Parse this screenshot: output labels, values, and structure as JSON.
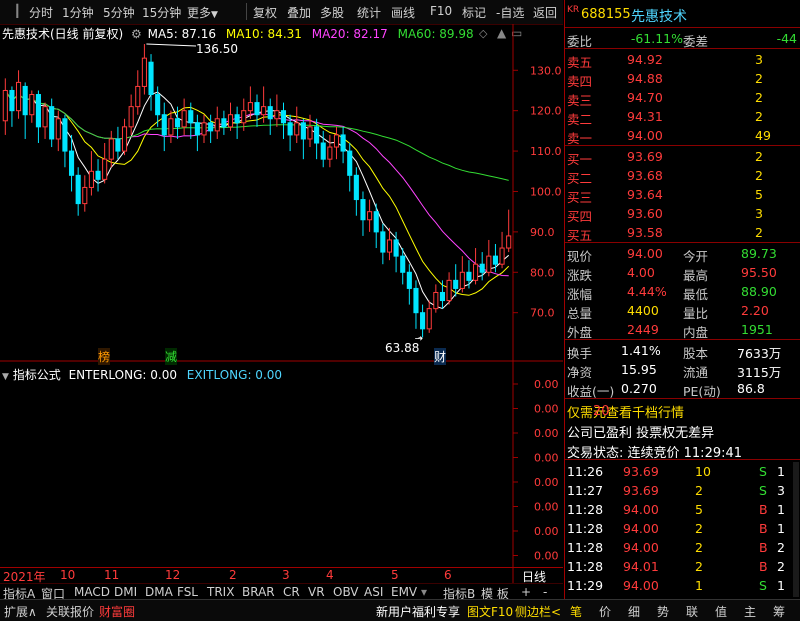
{
  "toolbar": {
    "left": [
      "分时",
      "1分钟",
      "5分钟",
      "15分钟",
      "更多"
    ],
    "right": [
      "复权",
      "叠加",
      "多股",
      "统计",
      "画线",
      "F10",
      "标记",
      "-自选",
      "返回"
    ]
  },
  "chart": {
    "title": "先惠技术(日线 前复权)",
    "ma": [
      {
        "label": "MA5: 87.16",
        "color": "#ffffff"
      },
      {
        "label": "MA10: 84.31",
        "color": "#ffff00"
      },
      {
        "label": "MA20: 82.17",
        "color": "#ff44ff"
      },
      {
        "label": "MA60: 89.98",
        "color": "#33dd33"
      }
    ],
    "y_ticks": [
      "130.0",
      "120.0",
      "110.0",
      "100.0",
      "90.0",
      "80.0",
      "70.0"
    ],
    "y_values": [
      130,
      120,
      110,
      100,
      90,
      80,
      70
    ],
    "high_label": "136.50",
    "low_label": "63.88",
    "markers": [
      {
        "text": "榜",
        "color": "#ff9900"
      },
      {
        "text": "减",
        "color": "#33dd33"
      },
      {
        "text": "财",
        "color": "#ffffff"
      }
    ],
    "x_labels": [
      "2021年",
      "10",
      "11",
      "12",
      "2",
      "3",
      "4",
      "5",
      "6"
    ],
    "period": "日线",
    "candles": [
      [
        117.5,
        125,
        128,
        114
      ],
      [
        125,
        120,
        126,
        116
      ],
      [
        120,
        127,
        130,
        118
      ],
      [
        126,
        119,
        127,
        113
      ],
      [
        119,
        124,
        125,
        117
      ],
      [
        124,
        116,
        125,
        112
      ],
      [
        116,
        121,
        122,
        113
      ],
      [
        121,
        113,
        123,
        111
      ],
      [
        113,
        118,
        120,
        110
      ],
      [
        118,
        110,
        119,
        106
      ],
      [
        110,
        104,
        114,
        100
      ],
      [
        104,
        97,
        106,
        94
      ],
      [
        97,
        101,
        104,
        95
      ],
      [
        101,
        105,
        110,
        99
      ],
      [
        105,
        103,
        108,
        100
      ],
      [
        103,
        108,
        112,
        102
      ],
      [
        108,
        113,
        115,
        106
      ],
      [
        113,
        110,
        116,
        108
      ],
      [
        110,
        116,
        118,
        109
      ],
      [
        116,
        121,
        124,
        114
      ],
      [
        121,
        126,
        130,
        119
      ],
      [
        126,
        133,
        136.5,
        124
      ],
      [
        132,
        124,
        134,
        120
      ],
      [
        124,
        119,
        126,
        116
      ],
      [
        119,
        114,
        122,
        110
      ],
      [
        114,
        118,
        120,
        112
      ],
      [
        118,
        116,
        121,
        113
      ],
      [
        116,
        120,
        123,
        114
      ],
      [
        120,
        117,
        122,
        113
      ],
      [
        117,
        114,
        119,
        110
      ],
      [
        114,
        117,
        119,
        112
      ],
      [
        117,
        115,
        119,
        112
      ],
      [
        115,
        118,
        121,
        113
      ],
      [
        118,
        116,
        120,
        114
      ],
      [
        116,
        119,
        122,
        115
      ],
      [
        119,
        117,
        121,
        113
      ],
      [
        117,
        120,
        123,
        115
      ],
      [
        120,
        122,
        126,
        118
      ],
      [
        122,
        119,
        124,
        116
      ],
      [
        119,
        121,
        126,
        117
      ],
      [
        121,
        118,
        123,
        114
      ],
      [
        118,
        120,
        124,
        116
      ],
      [
        120,
        117,
        122,
        113
      ],
      [
        117,
        114,
        119,
        110
      ],
      [
        114,
        117,
        121,
        112
      ],
      [
        117,
        113,
        118,
        108
      ],
      [
        113,
        116,
        119,
        111
      ],
      [
        116,
        112,
        118,
        108
      ],
      [
        112,
        108,
        115,
        106
      ],
      [
        108,
        111,
        114,
        106
      ],
      [
        111,
        114,
        116,
        108
      ],
      [
        114,
        110,
        116,
        107
      ],
      [
        110,
        104,
        112,
        100
      ],
      [
        104,
        98,
        106,
        94
      ],
      [
        98,
        93,
        100,
        89
      ],
      [
        93,
        95,
        98,
        90
      ],
      [
        95,
        90,
        97,
        86
      ],
      [
        90,
        85,
        92,
        82
      ],
      [
        85,
        88,
        91,
        83
      ],
      [
        88,
        84,
        90,
        80
      ],
      [
        84,
        80,
        86,
        77
      ],
      [
        80,
        76,
        82,
        72
      ],
      [
        76,
        70,
        78,
        66
      ],
      [
        70,
        66,
        72,
        63.88
      ],
      [
        66,
        71,
        73,
        65
      ],
      [
        71,
        75,
        77,
        70
      ],
      [
        75,
        73,
        78,
        71
      ],
      [
        73,
        78,
        80,
        72
      ],
      [
        78,
        76,
        82,
        74
      ],
      [
        76,
        80,
        84,
        75
      ],
      [
        80,
        78,
        83,
        76
      ],
      [
        78,
        82,
        86,
        77
      ],
      [
        82,
        80,
        85,
        78
      ],
      [
        80,
        84,
        88,
        79
      ],
      [
        84,
        82,
        87,
        80
      ],
      [
        82,
        86,
        90,
        81
      ],
      [
        86,
        89,
        95.5,
        85
      ]
    ],
    "ind_title": "指标公式",
    "ind_labels": [
      {
        "label": "ENTERLONG: 0.00",
        "color": "#ffffff"
      },
      {
        "label": "EXITLONG: 0.00",
        "color": "#4fd6ff"
      }
    ],
    "ind_ticks": [
      "0.00",
      "0.00",
      "0.00",
      "0.00",
      "0.00",
      "0.00",
      "0.00",
      "0.00"
    ]
  },
  "quote": {
    "market": "KR",
    "code": "688155",
    "name": "先惠技术",
    "wb_label": "委比",
    "wb_value": "-61.11%",
    "wc_label": "委差",
    "wc_value": "-44",
    "sells": [
      {
        "label": "卖五",
        "price": "94.92",
        "vol": "3"
      },
      {
        "label": "卖四",
        "price": "94.88",
        "vol": "2"
      },
      {
        "label": "卖三",
        "price": "94.70",
        "vol": "2"
      },
      {
        "label": "卖二",
        "price": "94.31",
        "vol": "2"
      },
      {
        "label": "卖一",
        "price": "94.00",
        "vol": "49"
      }
    ],
    "buys": [
      {
        "label": "买一",
        "price": "93.69",
        "vol": "2"
      },
      {
        "label": "买二",
        "price": "93.68",
        "vol": "2"
      },
      {
        "label": "买三",
        "price": "93.64",
        "vol": "5"
      },
      {
        "label": "买四",
        "price": "93.60",
        "vol": "3"
      },
      {
        "label": "买五",
        "price": "93.58",
        "vol": "2"
      }
    ],
    "stats1": [
      {
        "l1": "现价",
        "v1": "94.00",
        "c1": "red",
        "l2": "今开",
        "v2": "89.73",
        "c2": "green"
      },
      {
        "l1": "涨跌",
        "v1": "4.00",
        "c1": "red",
        "l2": "最高",
        "v2": "95.50",
        "c2": "red"
      },
      {
        "l1": "涨幅",
        "v1": "4.44%",
        "c1": "red",
        "l2": "最低",
        "v2": "88.90",
        "c2": "green"
      },
      {
        "l1": "总量",
        "v1": "4400",
        "c1": "yellow",
        "l2": "量比",
        "v2": "2.20",
        "c2": "red"
      },
      {
        "l1": "外盘",
        "v1": "2449",
        "c1": "red",
        "l2": "内盘",
        "v2": "1951",
        "c2": "green"
      }
    ],
    "stats2": [
      {
        "l1": "换手",
        "v1": "1.41%",
        "l2": "股本",
        "v2": "7633万"
      },
      {
        "l1": "净资",
        "v1": "15.95",
        "l2": "流通",
        "v2": "3115万"
      },
      {
        "l1": "收益(一)",
        "v1": "0.270",
        "l2": "PE(动)",
        "v2": "86.8"
      }
    ],
    "promo": "仅需20元查看千档行情",
    "promo_hl": "20",
    "profit": "公司已盈利 投票权无差异",
    "status": "交易状态: 连续竞价 11:29:41",
    "ticks": [
      {
        "t": "11:26",
        "p": "93.69",
        "v": "10",
        "d": "S",
        "n": "1"
      },
      {
        "t": "11:27",
        "p": "93.69",
        "v": "2",
        "d": "S",
        "n": "3"
      },
      {
        "t": "11:28",
        "p": "94.00",
        "v": "5",
        "d": "B",
        "n": "1"
      },
      {
        "t": "11:28",
        "p": "94.00",
        "v": "2",
        "d": "B",
        "n": "1"
      },
      {
        "t": "11:28",
        "p": "94.00",
        "v": "2",
        "d": "B",
        "n": "2"
      },
      {
        "t": "11:28",
        "p": "94.01",
        "v": "2",
        "d": "B",
        "n": "2"
      },
      {
        "t": "11:29",
        "p": "94.00",
        "v": "1",
        "d": "S",
        "n": "1"
      }
    ]
  },
  "bottom": {
    "row1": [
      "指标A",
      "窗口",
      "MACD",
      "DMI",
      "DMA",
      "FSL",
      "TRIX",
      "BRAR",
      "CR",
      "VR",
      "OBV",
      "ASI",
      "EMV",
      "指标B",
      "模 板",
      "+",
      "-"
    ],
    "row2_left": [
      "扩展∧",
      "关联报价",
      "财富圈"
    ],
    "row2_mid": [
      "新用户福利专享",
      "图文F10",
      "侧边栏<"
    ],
    "row2_right": [
      "笔",
      "价",
      "细",
      "势",
      "联",
      "值",
      "主",
      "筹"
    ]
  }
}
